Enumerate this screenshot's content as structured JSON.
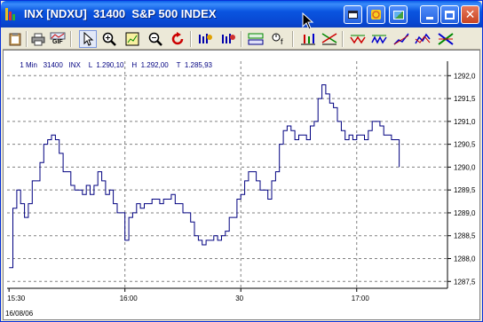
{
  "window": {
    "title": "INX [NDXU]  31400  S&P 500 INDEX",
    "title_bar_color": "#0a55e0"
  },
  "title_buttons": [
    "minimize-icon",
    "maximize-icon",
    "close-icon"
  ],
  "toolbar": {
    "tools": [
      "clipboard-icon",
      "print-icon",
      "gif-export-icon",
      "pointer-icon",
      "zoom-in-icon",
      "chart-grid-icon",
      "zoom-out-icon",
      "refresh-icon",
      "indicator-a-icon",
      "indicator-b-icon",
      "indicator-c-icon",
      "indicator-d-icon",
      "bar-style-icon",
      "candle-style-icon",
      "line-style-a-icon",
      "line-style-b-icon",
      "line-style-c-icon",
      "line-style-d-icon",
      "cross-style-icon"
    ],
    "gif_label": "GIF"
  },
  "info_bar": {
    "interval": "1 Min",
    "code": "31400",
    "symbol": "INX",
    "low": "L  1.290,10",
    "high": "H  1.292,00",
    "time": "T  1.285,93"
  },
  "chart_data": {
    "type": "line",
    "step": true,
    "y_ticks": [
      "1292,0",
      "1291,5",
      "1291,0",
      "1290,5",
      "1290,0",
      "1289,5",
      "1289,0",
      "1288,5",
      "1288,0",
      "1287,5"
    ],
    "y_tick_values": [
      1292.0,
      1291.5,
      1291.0,
      1290.5,
      1290.0,
      1289.5,
      1289.0,
      1288.5,
      1288.0,
      1287.5
    ],
    "ylim": [
      1287.35,
      1292.2
    ],
    "x_ticks": [
      "15:30",
      "16:00",
      "30",
      "17:00"
    ],
    "x_tick_minutes": [
      0,
      30,
      60,
      90
    ],
    "xlim": [
      -0.5,
      113.5
    ],
    "date_label": "16/08/06",
    "grid": true,
    "line_color": "#000080",
    "x": [
      0,
      1,
      2,
      3,
      4,
      5,
      6,
      7,
      8,
      9,
      10,
      11,
      12,
      13,
      14,
      15,
      16,
      17,
      18,
      19,
      20,
      21,
      22,
      23,
      24,
      25,
      26,
      27,
      28,
      29,
      30,
      31,
      32,
      33,
      34,
      35,
      36,
      37,
      38,
      39,
      40,
      41,
      42,
      43,
      44,
      45,
      46,
      47,
      48,
      49,
      50,
      51,
      52,
      53,
      54,
      55,
      56,
      57,
      58,
      59,
      60,
      61,
      62,
      63,
      64,
      65,
      66,
      67,
      68,
      69,
      70,
      71,
      72,
      73,
      74,
      75,
      76,
      77,
      78,
      79,
      80,
      81,
      82,
      83,
      84,
      85,
      86,
      87,
      88,
      89,
      90,
      91,
      92,
      93,
      94,
      95,
      96,
      97,
      98,
      99,
      100,
      101
    ],
    "y": [
      1287.8,
      1289.1,
      1289.5,
      1289.2,
      1288.9,
      1289.2,
      1289.7,
      1289.7,
      1290.1,
      1290.5,
      1290.6,
      1290.7,
      1290.6,
      1290.3,
      1289.9,
      1289.9,
      1289.6,
      1289.5,
      1289.5,
      1289.4,
      1289.6,
      1289.4,
      1289.6,
      1289.9,
      1289.7,
      1289.4,
      1289.5,
      1289.2,
      1289.0,
      1289.0,
      1288.4,
      1288.9,
      1289.0,
      1289.2,
      1289.1,
      1289.2,
      1289.2,
      1289.3,
      1289.3,
      1289.2,
      1289.3,
      1289.3,
      1289.4,
      1289.2,
      1289.2,
      1289.0,
      1289.0,
      1288.8,
      1288.5,
      1288.4,
      1288.3,
      1288.4,
      1288.4,
      1288.5,
      1288.4,
      1288.5,
      1288.6,
      1288.9,
      1288.9,
      1289.3,
      1289.4,
      1289.7,
      1289.9,
      1289.9,
      1289.7,
      1289.5,
      1289.5,
      1289.3,
      1289.7,
      1289.9,
      1290.5,
      1290.8,
      1290.9,
      1290.8,
      1290.6,
      1290.7,
      1290.7,
      1290.6,
      1290.9,
      1291.0,
      1291.5,
      1291.8,
      1291.6,
      1291.4,
      1291.3,
      1291.0,
      1290.8,
      1290.6,
      1290.7,
      1290.6,
      1290.7,
      1290.7,
      1290.6,
      1290.8,
      1291.0,
      1291.0,
      1290.9,
      1290.7,
      1290.7,
      1290.6,
      1290.6,
      1290.0
    ]
  }
}
